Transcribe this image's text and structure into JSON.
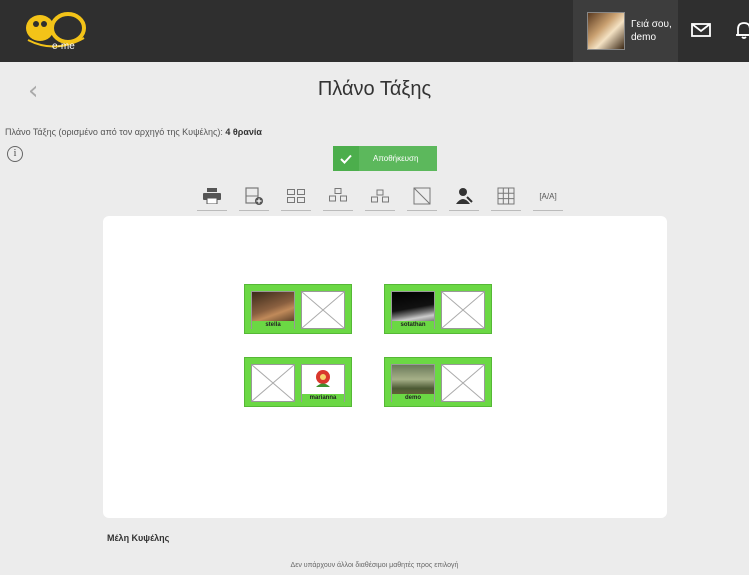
{
  "header": {
    "logo_text": "e-me",
    "greeting": "Γειά σου,",
    "username": "demo",
    "icons": [
      "envelope-icon",
      "bell-icon"
    ]
  },
  "page": {
    "title": "Πλάνο Τάξης",
    "subtitle_prefix": "Πλάνο Τάξης (ορισμένο από τον αρχηγό της Κυψέλης): ",
    "subtitle_value": "4 θρανία",
    "info_glyph": "i",
    "save_label": "Αποθήκευση"
  },
  "toolbar": {
    "tools": [
      "print-icon",
      "add-desk-icon",
      "layout-grid-icon",
      "layout-group-icon",
      "layout-cluster-icon",
      "empty-desk-icon",
      "person-icon",
      "table-grid-icon",
      "text-size"
    ],
    "text_tool_label": "[A/A]"
  },
  "desks": [
    {
      "left_seat": "stella",
      "right_seat": ""
    },
    {
      "left_seat": "sotathan",
      "right_seat": ""
    },
    {
      "left_seat": "",
      "right_seat": "marianna"
    },
    {
      "left_seat": "demo",
      "right_seat": ""
    }
  ],
  "members": {
    "heading": "Μέλη Κυψέλης",
    "empty_message": "Δεν υπάρχουν άλλοι διαθέσιμοι μαθητές προς επιλογή"
  },
  "colors": {
    "topbar": "#2f2f2f",
    "accent_green": "#5cb85c",
    "desk_green": "#6bd844"
  }
}
